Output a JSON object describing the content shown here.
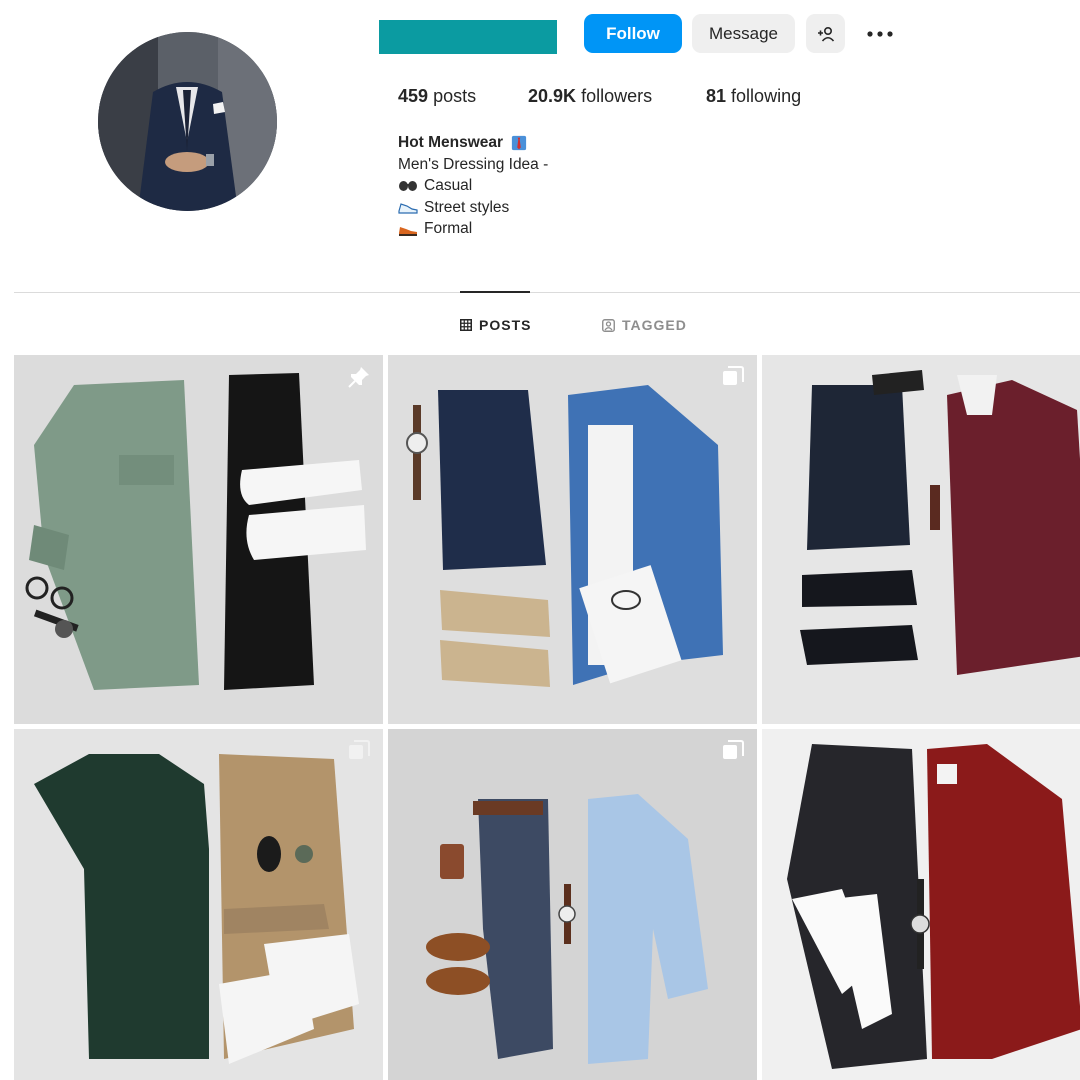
{
  "profile": {
    "follow_label": "Follow",
    "message_label": "Message",
    "stats": {
      "posts_count": "459",
      "posts_label": "posts",
      "followers_count": "20.9K",
      "followers_label": "followers",
      "following_count": "81",
      "following_label": "following"
    },
    "bio": {
      "name": "Hot Menswear",
      "name_emoji": "necktie-emoji",
      "line1": "Men's Dressing Idea -",
      "items": [
        {
          "emoji": "goggles-emoji",
          "text": "Casual"
        },
        {
          "emoji": "sneaker-emoji",
          "text": "Street styles"
        },
        {
          "emoji": "shoe-emoji",
          "text": "Formal"
        }
      ]
    }
  },
  "tabs": [
    {
      "label": "POSTS",
      "icon": "grid-icon",
      "active": true
    },
    {
      "label": "TAGGED",
      "icon": "tag-user-icon",
      "active": false
    }
  ],
  "posts": [
    {
      "description": "green shirt, black jeans, white sneakers flat-lay",
      "badge": "pin-icon"
    },
    {
      "description": "navy jeans, denim shirt, tan sneakers flat-lay",
      "badge": "carousel-icon"
    },
    {
      "description": "burgundy sweater, dark jeans, black sneakers flat-lay",
      "badge": "none"
    },
    {
      "description": "dark green tee, khaki chinos, white sneakers flat-lay",
      "badge": "carousel-icon"
    },
    {
      "description": "navy chinos, gingham shirt, brown loafers flat-lay",
      "badge": "carousel-icon"
    },
    {
      "description": "red shirt, charcoal pants, white sneakers flat-lay",
      "badge": "none"
    }
  ],
  "colors": {
    "accent": "#0095f6",
    "redacted_username": "#0b9ba1",
    "text": "#262626",
    "muted": "#8e8e8e"
  }
}
